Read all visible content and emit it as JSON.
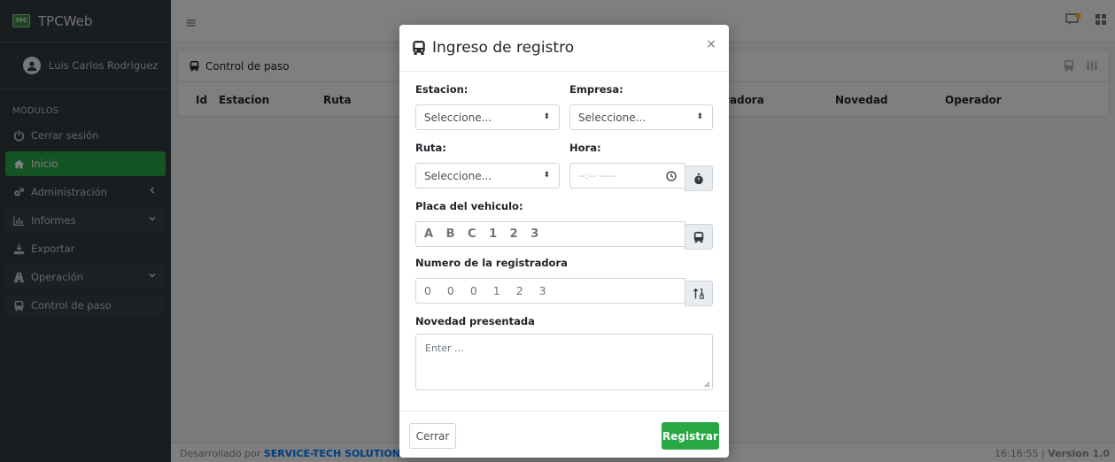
{
  "brand": {
    "name": "TPCWeb",
    "logo_text": "TPC"
  },
  "user": {
    "name": "Luis Carlos Rodriguez Mayo"
  },
  "sidebar": {
    "header": "MÓDULOS",
    "items": [
      {
        "label": "Cerrar sesión",
        "icon": "power-icon"
      },
      {
        "label": "Inicio",
        "icon": "home-icon",
        "active": true
      },
      {
        "label": "Administración",
        "icon": "gears-icon",
        "chevron": "left"
      },
      {
        "label": "Informes",
        "icon": "chart-icon",
        "chevron": "down"
      },
      {
        "label": "Exportar",
        "icon": "export-icon"
      },
      {
        "label": "Operación",
        "icon": "road-icon",
        "chevron": "down"
      },
      {
        "label": "Control de paso",
        "icon": "bus-icon"
      }
    ]
  },
  "topbar": {
    "menu_icon": "≡"
  },
  "main": {
    "card_title": "Control de paso",
    "columns": [
      "Id",
      "Estacion",
      "Ruta",
      "Registradora",
      "Novedad",
      "Operador"
    ]
  },
  "footer": {
    "developed_by_prefix": "Desarrollado por",
    "company": "SERVICE-TECH SOLUTIONS S.A.S.",
    "time": "16:16:55",
    "version": "Version 1.0"
  },
  "modal": {
    "title": "Ingreso de registro",
    "close_symbol": "×",
    "fields": {
      "estacion": {
        "label": "Estacion:",
        "value": "Seleccione..."
      },
      "empresa": {
        "label": "Empresa:",
        "value": "Seleccione..."
      },
      "ruta": {
        "label": "Ruta:",
        "value": "Seleccione..."
      },
      "hora": {
        "label": "Hora:",
        "placeholder": "--:-- -----"
      },
      "placa": {
        "label": "Placa del vehiculo:",
        "placeholder": "A B C 1 2 3"
      },
      "registradora": {
        "label": "Numero de la registradora",
        "placeholder": "0 0 0 1 2 3"
      },
      "novedad": {
        "label": "Novedad presentada",
        "placeholder": "Enter ..."
      }
    },
    "buttons": {
      "close": "Cerrar",
      "submit": "Registrar"
    }
  },
  "colors": {
    "sidebar": "#343a40",
    "active": "#28a745",
    "link": "#007bff"
  }
}
